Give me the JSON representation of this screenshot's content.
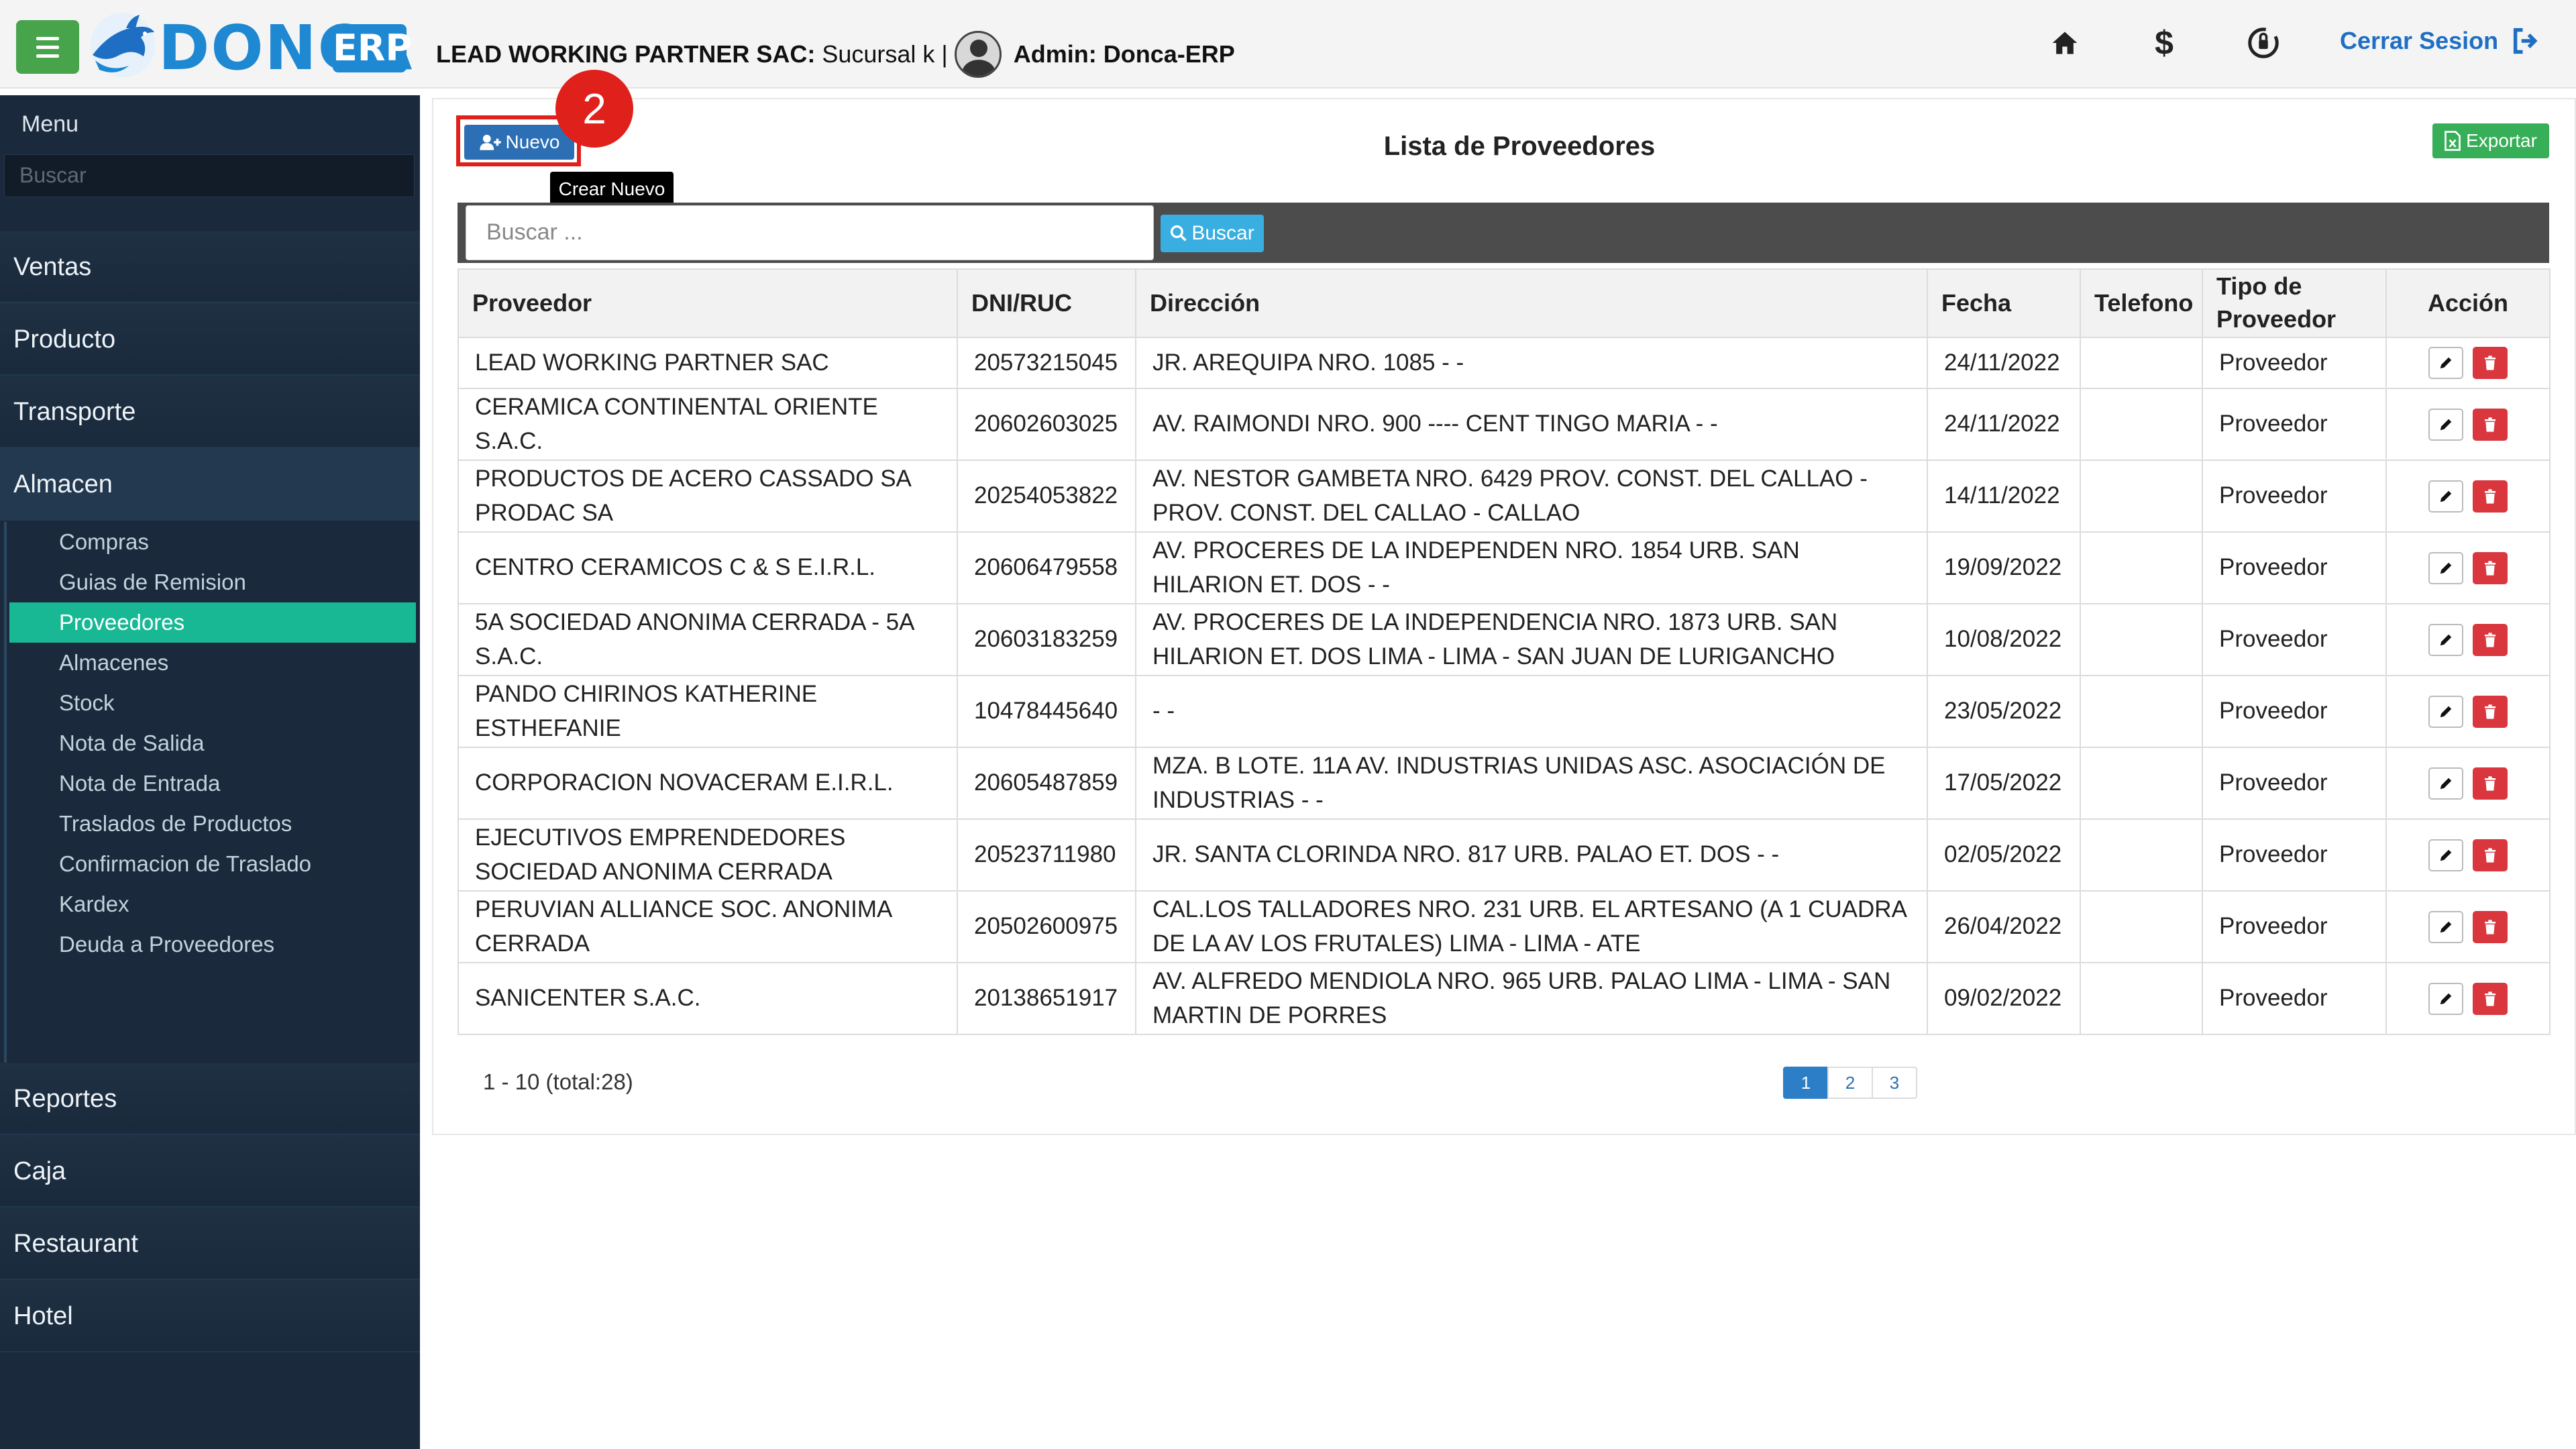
{
  "header": {
    "brand": "DONCA",
    "brand_suffix": "ERP",
    "company_name": "LEAD WORKING PARTNER SAC:",
    "branch": " Sucursal k |",
    "admin": "Admin: Donca-ERP",
    "logout_label": "Cerrar Sesion",
    "icons": [
      "home-icon",
      "dollar-icon",
      "cash-register-icon"
    ]
  },
  "sidebar": {
    "title": "Menu",
    "search_placeholder": "Buscar",
    "sections": [
      "Ventas",
      "Producto",
      "Transporte",
      "Almacen",
      "Reportes",
      "Caja",
      "Restaurant",
      "Hotel"
    ],
    "almacen_items": [
      "Compras",
      "Guias de Remision",
      "Proveedores",
      "Almacenes",
      "Stock",
      "Nota de Salida",
      "Nota de Entrada",
      "Traslados de Productos",
      "Confirmacion de Traslado",
      "Kardex",
      "Deuda a Proveedores"
    ],
    "selected_item": "Proveedores",
    "selected_color": "#19b894"
  },
  "main": {
    "new_label": "Nuevo",
    "step_number": "2",
    "tooltip": "Crear Nuevo",
    "title": "Lista de Proveedores",
    "export_label": "Exportar",
    "search_placeholder": "Buscar ...",
    "search_button": "Buscar",
    "columns": [
      "Proveedor",
      "DNI/RUC",
      "Dirección",
      "Fecha",
      "Telefono",
      "Tipo de Proveedor",
      "Acción"
    ],
    "rows": [
      {
        "proveedor": "LEAD WORKING PARTNER SAC",
        "ruc": "20573215045",
        "direccion": "JR. AREQUIPA NRO. 1085 - -",
        "fecha": "24/11/2022",
        "telefono": "",
        "tipo": "Proveedor"
      },
      {
        "proveedor": "CERAMICA CONTINENTAL ORIENTE S.A.C.",
        "ruc": "20602603025",
        "direccion": "AV. RAIMONDI NRO. 900 ---- CENT TINGO MARIA - -",
        "fecha": "24/11/2022",
        "telefono": "",
        "tipo": "Proveedor"
      },
      {
        "proveedor": "PRODUCTOS DE ACERO CASSADO SA PRODAC SA",
        "ruc": "20254053822",
        "direccion": "AV. NESTOR GAMBETA NRO. 6429 PROV. CONST. DEL CALLAO - PROV. CONST. DEL CALLAO - CALLAO",
        "fecha": "14/11/2022",
        "telefono": "",
        "tipo": "Proveedor"
      },
      {
        "proveedor": "CENTRO CERAMICOS C & S E.I.R.L.",
        "ruc": "20606479558",
        "direccion": "AV. PROCERES DE LA INDEPENDEN NRO. 1854 URB. SAN HILARION ET. DOS - -",
        "fecha": "19/09/2022",
        "telefono": "",
        "tipo": "Proveedor"
      },
      {
        "proveedor": "5A SOCIEDAD ANONIMA CERRADA - 5A S.A.C.",
        "ruc": "20603183259",
        "direccion": "AV. PROCERES DE LA INDEPENDENCIA NRO. 1873 URB. SAN HILARION ET. DOS LIMA - LIMA - SAN JUAN DE LURIGANCHO",
        "fecha": "10/08/2022",
        "telefono": "",
        "tipo": "Proveedor"
      },
      {
        "proveedor": "PANDO CHIRINOS KATHERINE ESTHEFANIE",
        "ruc": "10478445640",
        "direccion": "- -",
        "fecha": "23/05/2022",
        "telefono": "",
        "tipo": "Proveedor"
      },
      {
        "proveedor": "CORPORACION NOVACERAM E.I.R.L.",
        "ruc": "20605487859",
        "direccion": "MZA. B LOTE. 11A AV. INDUSTRIAS UNIDAS ASC. ASOCIACIÓN DE INDUSTRIAS - -",
        "fecha": "17/05/2022",
        "telefono": "",
        "tipo": "Proveedor"
      },
      {
        "proveedor": "EJECUTIVOS EMPRENDEDORES SOCIEDAD ANONIMA CERRADA",
        "ruc": "20523711980",
        "direccion": "JR. SANTA CLORINDA NRO. 817 URB. PALAO ET. DOS - -",
        "fecha": "02/05/2022",
        "telefono": "",
        "tipo": "Proveedor"
      },
      {
        "proveedor": "PERUVIAN ALLIANCE SOC. ANONIMA CERRADA",
        "ruc": "20502600975",
        "direccion": "CAL.LOS TALLADORES NRO. 231 URB. EL ARTESANO (A 1 CUADRA DE LA AV LOS FRUTALES) LIMA - LIMA - ATE",
        "fecha": "26/04/2022",
        "telefono": "",
        "tipo": "Proveedor"
      },
      {
        "proveedor": "SANICENTER S.A.C.",
        "ruc": "20138651917",
        "direccion": "AV. ALFREDO MENDIOLA NRO. 965 URB. PALAO LIMA - LIMA - SAN MARTIN DE PORRES",
        "fecha": "09/02/2022",
        "telefono": "",
        "tipo": "Proveedor"
      }
    ],
    "range_text": "1 - 10 (total:28)",
    "pages": [
      "1",
      "2",
      "3"
    ],
    "current_page": "1"
  },
  "colors": {
    "accent_green": "#47a44b",
    "primary_blue": "#2c6fb5",
    "highlight_red": "#e0201b",
    "sidebar_bg": "#1a2a3c"
  }
}
